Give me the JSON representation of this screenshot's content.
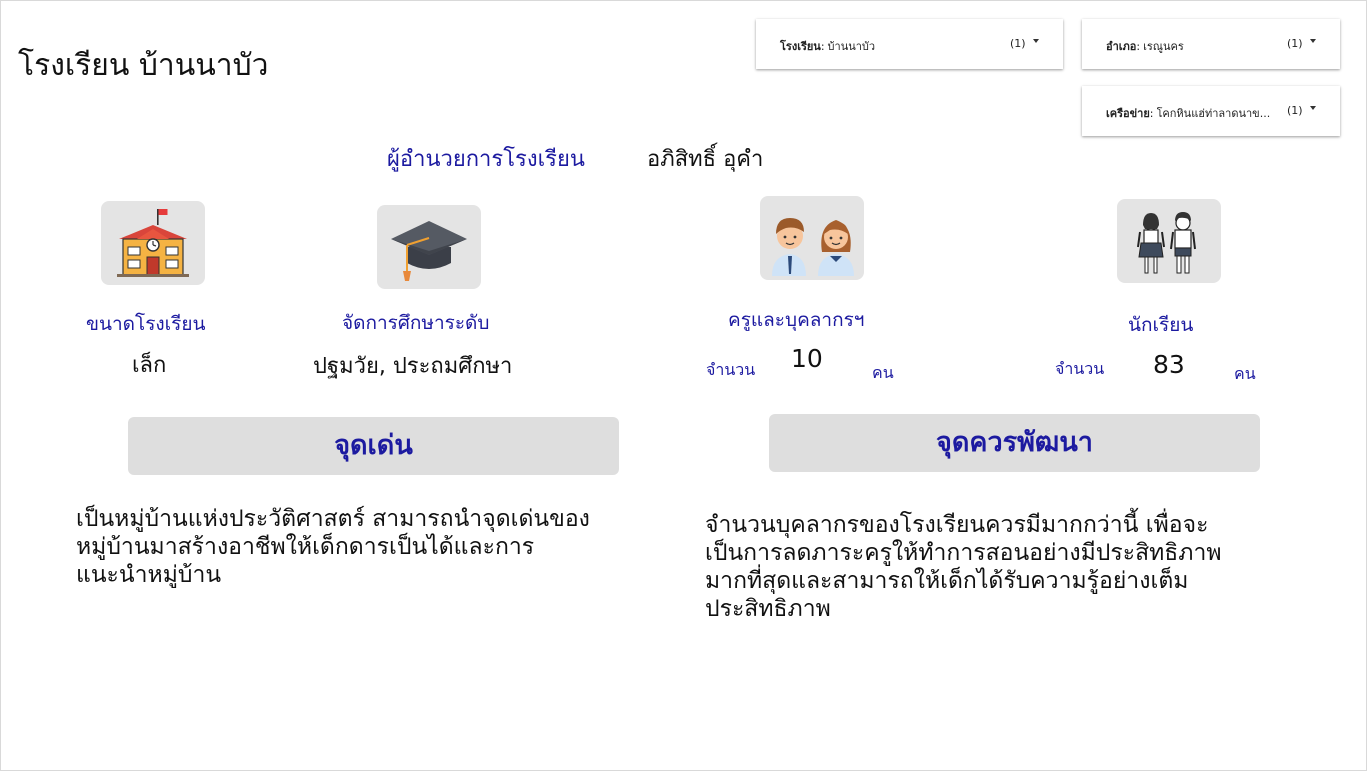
{
  "school_name": "โรงเรียน บ้านนาบัว",
  "filters": [
    {
      "label": "โรงเรียน",
      "value": "บ้านนาบัว",
      "count": "(1)"
    },
    {
      "label": "อำเภอ",
      "value": "เรณูนคร",
      "count": "(1)"
    },
    {
      "label": "เครือข่าย",
      "value": "โคกหินแฮ่ท่าลาดนาข...",
      "count": "(1)"
    }
  ],
  "director": {
    "label": "ผู้อำนวยการโรงเรียน",
    "name": "อภิสิทธิ์ อุคำ"
  },
  "school_size": {
    "label": "ขนาดโรงเรียน",
    "value": "เล็ก"
  },
  "education_level": {
    "label": "จัดการศึกษาระดับ",
    "value": "ปฐมวัย, ประถมศึกษา"
  },
  "staff": {
    "label": "ครูและบุคลากรฯ",
    "count_label": "จำนวน",
    "count": "10",
    "unit": "คน"
  },
  "students": {
    "label": "นักเรียน",
    "count_label": "จำนวน",
    "count": "83",
    "unit": "คน"
  },
  "strengths": {
    "title": "จุดเด่น",
    "lines": [
      "เป็นหมู่บ้านแห่งประวัติศาสตร์ สามารถนำจุดเด่นของ",
      "หมู่บ้านมาสร้างอาชีพให้เด็กดารเป็นได้และการ",
      "แนะนำหมู่บ้าน"
    ]
  },
  "improvements": {
    "title": "จุดควรพัฒนา",
    "lines": [
      "จำนวนบุคลากรของโรงเรียนควรมีมากกว่านี้ เพื่อจะ",
      "เป็นการลดภาระครูให้ทำการสอนอย่างมีประสิทธิภาพ",
      "มากที่สุดและสามารถให้เด็กได้รับความรู้อย่างเต็ม",
      "ประสิทธิภาพ"
    ]
  },
  "icons": [
    "school-building-icon",
    "graduation-cap-icon",
    "teachers-icon",
    "students-icon"
  ],
  "colors": {
    "accent": "#1c1aa0",
    "tile": "#e4e4e4",
    "section": "#dedede"
  }
}
